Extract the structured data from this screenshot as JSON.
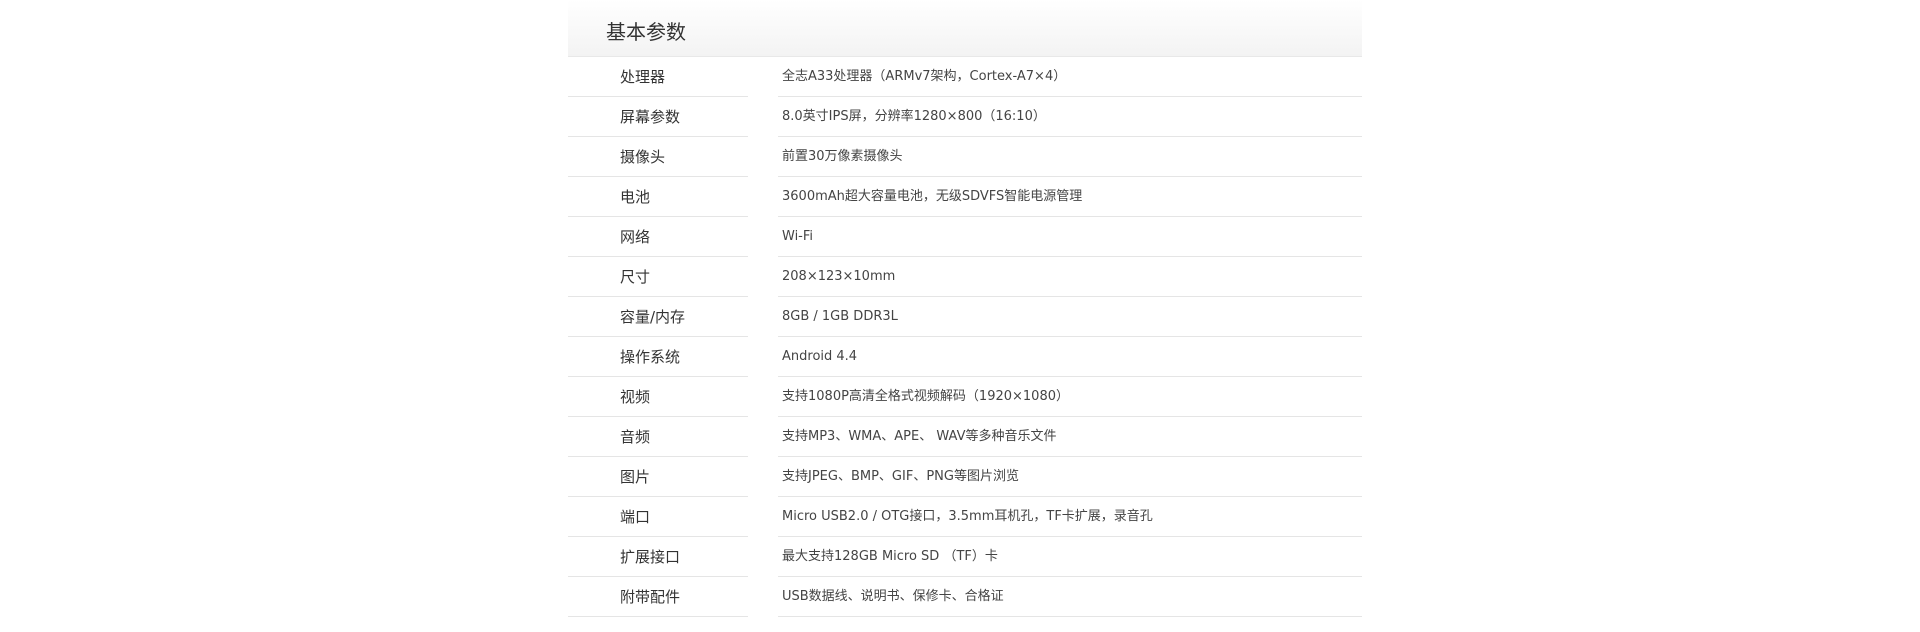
{
  "section": {
    "title": "基本参数"
  },
  "specs": [
    {
      "label": "处理器",
      "value": "全志A33处理器（ARMv7架构，Cortex-A7×4）"
    },
    {
      "label": "屏幕参数",
      "value": "8.0英寸IPS屏，分辨率1280×800（16:10）"
    },
    {
      "label": "摄像头",
      "value": "前置30万像素摄像头"
    },
    {
      "label": "电池",
      "value": "3600mAh超大容量电池，无级SDVFS智能电源管理"
    },
    {
      "label": "网络",
      "value": "Wi-Fi"
    },
    {
      "label": "尺寸",
      "value": "208×123×10mm"
    },
    {
      "label": "容量/内存",
      "value": "8GB / 1GB DDR3L"
    },
    {
      "label": "操作系统",
      "value": "Android 4.4"
    },
    {
      "label": "视频",
      "value": "支持1080P高清全格式视频解码（1920×1080）"
    },
    {
      "label": "音频",
      "value": "支持MP3、WMA、APE、 WAV等多种音乐文件"
    },
    {
      "label": "图片",
      "value": "支持JPEG、BMP、GIF、PNG等图片浏览"
    },
    {
      "label": "端口",
      "value": "Micro USB2.0 / OTG接口，3.5mm耳机孔，TF卡扩展，录音孔"
    },
    {
      "label": "扩展接口",
      "value": "最大支持128GB Micro SD （TF）卡"
    },
    {
      "label": "附带配件",
      "value": "USB数据线、说明书、保修卡、合格证"
    }
  ]
}
